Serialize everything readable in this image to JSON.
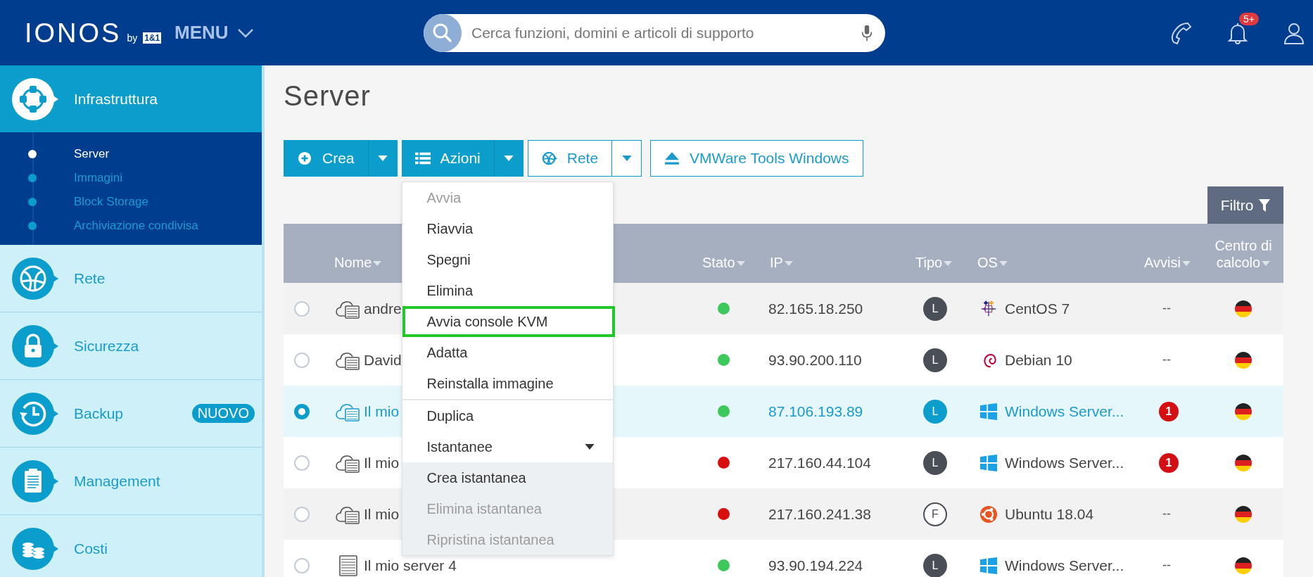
{
  "header": {
    "logo": "IONOS",
    "logo_by": "by",
    "logo_brand": "1&1",
    "menu": "MENU",
    "search": {
      "placeholder": "Cerca funzioni, domini e articoli di supporto"
    },
    "notifications_badge": "5+"
  },
  "sidebar": {
    "items": [
      {
        "kind": "infrastructure",
        "label": "Infrastruttura",
        "selected": true,
        "children": [
          {
            "label": "Server",
            "selected": true
          },
          {
            "label": "Immagini",
            "selected": false
          },
          {
            "label": "Block Storage",
            "selected": false
          },
          {
            "label": "Archiviazione condivisa",
            "selected": false
          }
        ]
      },
      {
        "kind": "network",
        "label": "Rete",
        "selected": false
      },
      {
        "kind": "lock",
        "label": "Sicurezza",
        "selected": false
      },
      {
        "kind": "backup",
        "label": "Backup",
        "selected": false,
        "badge": "NUOVO"
      },
      {
        "kind": "clipboard",
        "label": "Management",
        "selected": false
      },
      {
        "kind": "coins",
        "label": "Costi",
        "selected": false
      }
    ]
  },
  "page": {
    "title": "Server"
  },
  "toolbar": [
    {
      "kind": "create",
      "label": "Crea"
    },
    {
      "kind": "actions",
      "label": "Azioni",
      "menu": [
        {
          "kind": "item",
          "label": "Avvia",
          "disabled": true,
          "highlighted": false
        },
        {
          "kind": "item",
          "label": "Riavvia",
          "disabled": false,
          "highlighted": false
        },
        {
          "kind": "item",
          "label": "Spegni",
          "disabled": false,
          "highlighted": false
        },
        {
          "kind": "item",
          "label": "Elimina",
          "disabled": false,
          "highlighted": false
        },
        {
          "kind": "item",
          "label": "Avvia console KVM",
          "disabled": false,
          "highlighted": true
        },
        {
          "kind": "item",
          "label": "Adatta",
          "disabled": false,
          "highlighted": false
        },
        {
          "kind": "item",
          "label": "Reinstalla immagine",
          "disabled": false,
          "highlighted": false
        },
        {
          "kind": "divider"
        },
        {
          "kind": "item",
          "label": "Duplica",
          "disabled": false,
          "highlighted": false
        },
        {
          "kind": "submenu",
          "label": "Istantanee",
          "disabled": false,
          "highlighted": false,
          "expanded": true
        },
        {
          "kind": "subitem",
          "label": "Crea istantanea",
          "disabled": false,
          "highlighted": false
        },
        {
          "kind": "subitem",
          "label": "Elimina istantanea",
          "disabled": true,
          "highlighted": false
        },
        {
          "kind": "subitem",
          "label": "Ripristina istantanea",
          "disabled": true,
          "highlighted": false
        }
      ]
    },
    {
      "kind": "network",
      "label": "Rete"
    },
    {
      "kind": "eject",
      "label": "VMWare Tools Windows"
    }
  ],
  "filter_button": "Filtro",
  "table": {
    "columns": [
      {
        "label": "Nome",
        "sortable": true
      },
      {
        "label": "Stato",
        "sortable": true
      },
      {
        "label": "IP",
        "sortable": true
      },
      {
        "label": "Tipo",
        "sortable": true
      },
      {
        "label": "OS",
        "sortable": true
      },
      {
        "label": "Avvisi",
        "sortable": true
      },
      {
        "label": "Centro di calcolo",
        "sortable": true
      }
    ],
    "rows": [
      {
        "selected": false,
        "kind": "cloud-server",
        "name": "andre",
        "color": "#3cc85a",
        "ip": "82.165.18.250",
        "type": {
          "letter": "L",
          "kind": "filled"
        },
        "os": {
          "kind": "centos",
          "name": "CentOS 7"
        },
        "alerts": {
          "kind": "text",
          "value": "--"
        }
      },
      {
        "selected": false,
        "kind": "cloud-server",
        "name": "David",
        "color": "#3cc85a",
        "ip": "93.90.200.110",
        "type": {
          "letter": "L",
          "kind": "filled"
        },
        "os": {
          "kind": "debian",
          "name": "Debian 10"
        },
        "alerts": {
          "kind": "text",
          "value": "--"
        }
      },
      {
        "selected": true,
        "kind": "cloud-server",
        "name": "Il mio",
        "color": "#3cc85a",
        "ip": "87.106.193.89",
        "type": {
          "letter": "L",
          "kind": "filled"
        },
        "os": {
          "kind": "windows",
          "name": "Windows Server..."
        },
        "alerts": {
          "kind": "badge",
          "value": "1"
        }
      },
      {
        "selected": false,
        "kind": "cloud-server",
        "name": "Il mio",
        "color": "#d90f0f",
        "ip": "217.160.44.104",
        "type": {
          "letter": "L",
          "kind": "filled"
        },
        "os": {
          "kind": "windows",
          "name": "Windows Server..."
        },
        "alerts": {
          "kind": "badge",
          "value": "1"
        }
      },
      {
        "selected": false,
        "kind": "cloud-server",
        "name": "Il mio",
        "color": "#d90f0f",
        "ip": "217.160.241.38",
        "type": {
          "letter": "F",
          "kind": "outline"
        },
        "os": {
          "kind": "ubuntu",
          "name": "Ubuntu 18.04"
        },
        "alerts": {
          "kind": "text",
          "value": "--"
        }
      },
      {
        "selected": false,
        "kind": "server",
        "name": "Il mio server 4",
        "color": "#3cc85a",
        "ip": "93.90.194.224",
        "type": {
          "letter": "L",
          "kind": "filled"
        },
        "os": {
          "kind": "windows",
          "name": "Windows Server..."
        },
        "alerts": {
          "kind": "text",
          "value": "--"
        }
      }
    ]
  }
}
